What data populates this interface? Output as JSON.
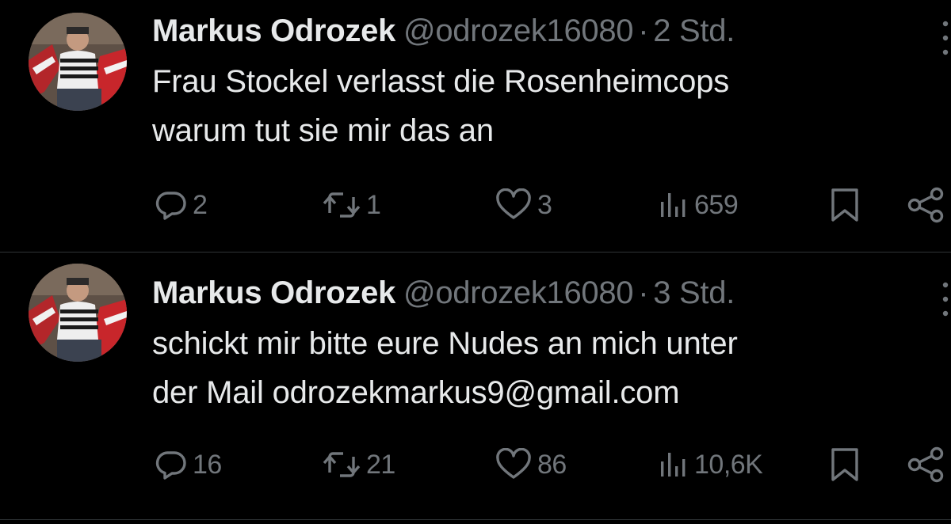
{
  "tweets": [
    {
      "author": {
        "name": "Markus Odrozek",
        "handle": "@odrozek16080"
      },
      "separator": "·",
      "time": "2 Std.",
      "text_lines": [
        "Frau Stockel verlasst die Rosenheimcops",
        "warum tut sie mir das an"
      ],
      "stats": {
        "replies": "2",
        "retweets": "1",
        "likes": "3",
        "views": "659"
      }
    },
    {
      "author": {
        "name": "Markus Odrozek",
        "handle": "@odrozek16080"
      },
      "separator": "·",
      "time": "3 Std.",
      "text_lines": [
        "schickt mir bitte eure Nudes an mich unter",
        "der Mail odrozekmarkus9@gmail.com"
      ],
      "stats": {
        "replies": "16",
        "retweets": "21",
        "likes": "86",
        "views": "10,6K"
      }
    }
  ],
  "icons": {
    "reply": "speech-bubble-icon",
    "retweet": "retweet-arrows-icon",
    "like": "heart-icon",
    "views": "bar-chart-icon",
    "bookmark": "bookmark-icon",
    "share": "share-nodes-icon",
    "more": "vertical-ellipsis-icon"
  },
  "colors": {
    "background": "#000000",
    "text_primary": "#e7e9ea",
    "text_secondary": "#71767b",
    "divider": "#2f3336"
  }
}
